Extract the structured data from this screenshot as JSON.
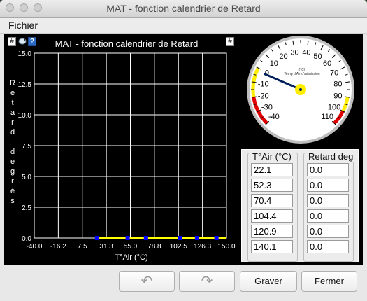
{
  "window": {
    "title": "MAT - fonction calendrier de Retard"
  },
  "menu": {
    "items": [
      "Fichier"
    ]
  },
  "chart_panel": {
    "hash_left": "#",
    "hash_right": "#",
    "help": "?"
  },
  "chart_data": {
    "type": "line",
    "title": "MAT - fonction calendrier de Retard",
    "xlabel": "T°Air (°C)",
    "ylabel": "Retard degrés",
    "xlim": [
      -40.0,
      150.0
    ],
    "ylim": [
      0.0,
      15.0
    ],
    "x_ticks": [
      "-40.0",
      "-16.2",
      "7.5",
      "31.3",
      "55.0",
      "78.8",
      "102.5",
      "126.3",
      "150.0"
    ],
    "y_ticks": [
      "0.0",
      "2.5",
      "5.0",
      "7.5",
      "10.0",
      "12.5",
      "15.0"
    ],
    "series": [
      {
        "x": [
          22.1,
          52.3,
          70.4,
          104.4,
          120.9,
          140.1
        ],
        "y": [
          0.0,
          0.0,
          0.0,
          0.0,
          0.0,
          0.0
        ],
        "line_color": "#ffff00",
        "marker_color": "#0000ff"
      }
    ],
    "grid": true
  },
  "gauge": {
    "labels": [
      "-40",
      "-30",
      "-20",
      "-10",
      "0",
      "10",
      "20",
      "30",
      "40",
      "50",
      "60",
      "70",
      "80",
      "90",
      "100",
      "110"
    ],
    "values": [
      -40,
      -30,
      -20,
      -10,
      0,
      10,
      20,
      30,
      40,
      50,
      60,
      70,
      80,
      90,
      100,
      110
    ],
    "unit": "(°C)",
    "caption": "Temp d'Air d'admission",
    "min": -40,
    "max": 110,
    "needle_value": -2
  },
  "table": {
    "col1_header": "T°Air (°C)",
    "col2_header": "Retard deg",
    "col1": [
      "22.1",
      "52.3",
      "70.4",
      "104.4",
      "120.9",
      "140.1"
    ],
    "col2": [
      "0.0",
      "0.0",
      "0.0",
      "0.0",
      "0.0",
      "0.0"
    ]
  },
  "buttons": {
    "undo": "↶",
    "redo": "↷",
    "burn": "Graver",
    "close": "Fermer"
  }
}
